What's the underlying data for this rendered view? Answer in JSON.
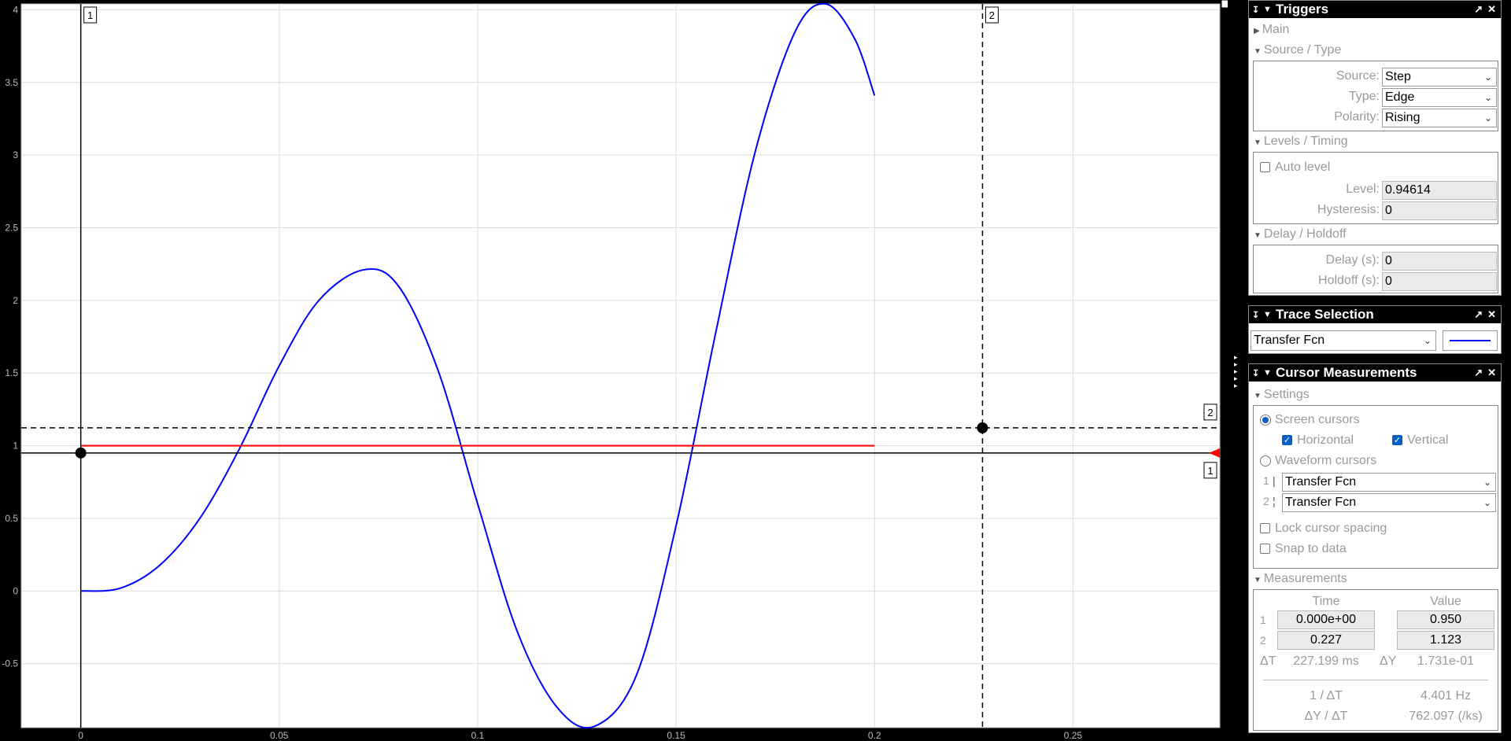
{
  "chart_data": {
    "type": "line",
    "xlim": [
      -0.015,
      0.287
    ],
    "ylim": [
      -0.94,
      4.04
    ],
    "x_ticks": [
      "0",
      "0.05",
      "0.1",
      "0.15",
      "0.2",
      "0.25"
    ],
    "y_ticks": [
      "-0.5",
      "0",
      "0.5",
      "1",
      "1.5",
      "2",
      "2.5",
      "3",
      "3.5",
      "4"
    ],
    "grid": true,
    "series": [
      {
        "color": "#0000ff",
        "x": [
          0,
          0.01,
          0.02,
          0.03,
          0.04,
          0.05,
          0.06,
          0.0712,
          0.08,
          0.09,
          0.1,
          0.11,
          0.12,
          0.1295,
          0.14,
          0.15,
          0.16,
          0.17,
          0.18,
          0.1877,
          0.195,
          0.2
        ],
        "y": [
          0,
          0.02,
          0.18,
          0.5,
          0.98,
          1.55,
          2.0,
          2.21,
          2.1,
          1.52,
          0.6,
          -0.28,
          -0.8,
          -0.93,
          -0.58,
          0.45,
          1.78,
          3.03,
          3.85,
          4.04,
          3.8,
          3.41
        ]
      },
      {
        "color": "#ff0000",
        "x": [
          0,
          0.2
        ],
        "y": [
          1,
          1
        ]
      }
    ],
    "cursors": {
      "t1": 0,
      "t2": 0.2272,
      "v1": 0.95,
      "v2": 1.123,
      "t1_label": "1",
      "t2_label": "2",
      "v1_label": "1",
      "v2_label": "2"
    }
  },
  "triggers": {
    "title": "Triggers",
    "main": "Main",
    "source_type": "Source / Type",
    "source_label": "Source:",
    "source_value": "Step",
    "type_label": "Type:",
    "type_value": "Edge",
    "polarity_label": "Polarity:",
    "polarity_value": "Rising",
    "levels_timing": "Levels / Timing",
    "auto_level": "Auto level",
    "level_label": "Level:",
    "level_value": "0.94614",
    "hysteresis_label": "Hysteresis:",
    "hysteresis_value": "0",
    "delay_holdoff": "Delay / Holdoff",
    "delay_label": "Delay (s):",
    "delay_value": "0",
    "holdoff_label": "Holdoff (s):",
    "holdoff_value": "0"
  },
  "trace": {
    "title": "Trace Selection",
    "value": "Transfer Fcn",
    "line_color": "#0000ff"
  },
  "cursor": {
    "title": "Cursor Measurements",
    "settings": "Settings",
    "screen_cursors": "Screen cursors",
    "horizontal": "Horizontal",
    "vertical": "Vertical",
    "waveform_cursors": "Waveform cursors",
    "wf1_index": "1",
    "wf1_value": "Transfer Fcn",
    "wf2_index": "2",
    "wf2_value": "Transfer Fcn",
    "lock_spacing": "Lock cursor spacing",
    "snap": "Snap to data",
    "measurements": "Measurements",
    "col_time": "Time",
    "col_value": "Value",
    "row1_index": "1",
    "row1_time": "0.000e+00",
    "row1_value": "0.950",
    "row2_index": "2",
    "row2_time": "0.227",
    "row2_value": "1.123",
    "dt_label": "ΔT",
    "dt_value": "227.199 ms",
    "dy_label": "ΔY",
    "dy_value": "1.731e-01",
    "inv_dt_label": "1 / ΔT",
    "inv_dt_value": "4.401 Hz",
    "dydt_label": "ΔY / ΔT",
    "dydt_value": "762.097 (/ks)"
  },
  "icons": {
    "pin": "pin-icon",
    "collapse": "collapse-icon",
    "undock": "undock-icon",
    "close": "close-icon"
  }
}
